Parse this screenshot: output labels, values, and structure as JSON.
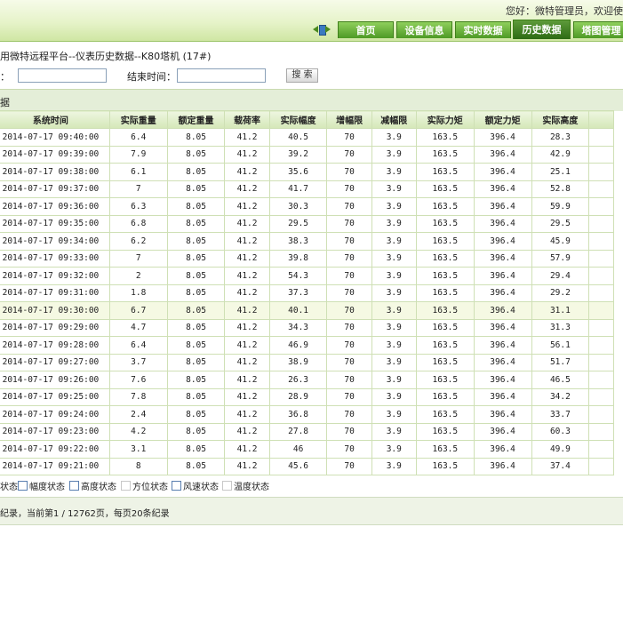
{
  "header": {
    "welcome": "您好：微特管理员，欢迎使",
    "nav": [
      "首页",
      "设备信息",
      "实时数据",
      "历史数据",
      "塔图管理"
    ],
    "active_tab": "历史数据"
  },
  "page_title": "用微特远程平台--仪表历史数据--K80塔机 (17#)",
  "search": {
    "start_label": "：",
    "end_label": "结束时间：",
    "start_value": "",
    "end_value": "",
    "button": "搜 索"
  },
  "panel_title": "据",
  "table": {
    "headers": [
      "系统时间",
      "实际重量",
      "额定重量",
      "载荷率",
      "实际幅度",
      "增幅限",
      "减幅限",
      "实际力矩",
      "额定力矩",
      "实际高度",
      ""
    ],
    "highlight_row": 10,
    "rows": [
      [
        "2014-07-17 09:40:00",
        "6.4",
        "8.05",
        "41.2",
        "40.5",
        "70",
        "3.9",
        "163.5",
        "396.4",
        "28.3",
        ""
      ],
      [
        "2014-07-17 09:39:00",
        "7.9",
        "8.05",
        "41.2",
        "39.2",
        "70",
        "3.9",
        "163.5",
        "396.4",
        "42.9",
        ""
      ],
      [
        "2014-07-17 09:38:00",
        "6.1",
        "8.05",
        "41.2",
        "35.6",
        "70",
        "3.9",
        "163.5",
        "396.4",
        "25.1",
        ""
      ],
      [
        "2014-07-17 09:37:00",
        "7",
        "8.05",
        "41.2",
        "41.7",
        "70",
        "3.9",
        "163.5",
        "396.4",
        "52.8",
        ""
      ],
      [
        "2014-07-17 09:36:00",
        "6.3",
        "8.05",
        "41.2",
        "30.3",
        "70",
        "3.9",
        "163.5",
        "396.4",
        "59.9",
        ""
      ],
      [
        "2014-07-17 09:35:00",
        "6.8",
        "8.05",
        "41.2",
        "29.5",
        "70",
        "3.9",
        "163.5",
        "396.4",
        "29.5",
        ""
      ],
      [
        "2014-07-17 09:34:00",
        "6.2",
        "8.05",
        "41.2",
        "38.3",
        "70",
        "3.9",
        "163.5",
        "396.4",
        "45.9",
        ""
      ],
      [
        "2014-07-17 09:33:00",
        "7",
        "8.05",
        "41.2",
        "39.8",
        "70",
        "3.9",
        "163.5",
        "396.4",
        "57.9",
        ""
      ],
      [
        "2014-07-17 09:32:00",
        "2",
        "8.05",
        "41.2",
        "54.3",
        "70",
        "3.9",
        "163.5",
        "396.4",
        "29.4",
        ""
      ],
      [
        "2014-07-17 09:31:00",
        "1.8",
        "8.05",
        "41.2",
        "37.3",
        "70",
        "3.9",
        "163.5",
        "396.4",
        "29.2",
        ""
      ],
      [
        "2014-07-17 09:30:00",
        "6.7",
        "8.05",
        "41.2",
        "40.1",
        "70",
        "3.9",
        "163.5",
        "396.4",
        "31.1",
        ""
      ],
      [
        "2014-07-17 09:29:00",
        "4.7",
        "8.05",
        "41.2",
        "34.3",
        "70",
        "3.9",
        "163.5",
        "396.4",
        "31.3",
        ""
      ],
      [
        "2014-07-17 09:28:00",
        "6.4",
        "8.05",
        "41.2",
        "46.9",
        "70",
        "3.9",
        "163.5",
        "396.4",
        "56.1",
        ""
      ],
      [
        "2014-07-17 09:27:00",
        "3.7",
        "8.05",
        "41.2",
        "38.9",
        "70",
        "3.9",
        "163.5",
        "396.4",
        "51.7",
        ""
      ],
      [
        "2014-07-17 09:26:00",
        "7.6",
        "8.05",
        "41.2",
        "26.3",
        "70",
        "3.9",
        "163.5",
        "396.4",
        "46.5",
        ""
      ],
      [
        "2014-07-17 09:25:00",
        "7.8",
        "8.05",
        "41.2",
        "28.9",
        "70",
        "3.9",
        "163.5",
        "396.4",
        "34.2",
        ""
      ],
      [
        "2014-07-17 09:24:00",
        "2.4",
        "8.05",
        "41.2",
        "36.8",
        "70",
        "3.9",
        "163.5",
        "396.4",
        "33.7",
        ""
      ],
      [
        "2014-07-17 09:23:00",
        "4.2",
        "8.05",
        "41.2",
        "27.8",
        "70",
        "3.9",
        "163.5",
        "396.4",
        "60.3",
        ""
      ],
      [
        "2014-07-17 09:22:00",
        "3.1",
        "8.05",
        "41.2",
        "46",
        "70",
        "3.9",
        "163.5",
        "396.4",
        "49.9",
        ""
      ],
      [
        "2014-07-17 09:21:00",
        "8",
        "8.05",
        "41.2",
        "45.6",
        "70",
        "3.9",
        "163.5",
        "396.4",
        "37.4",
        ""
      ]
    ]
  },
  "checks": [
    {
      "label": "状态",
      "box": false,
      "light": false
    },
    {
      "label": "幅度状态",
      "box": true,
      "light": false
    },
    {
      "label": "高度状态",
      "box": true,
      "light": false
    },
    {
      "label": "方位状态",
      "box": true,
      "light": true
    },
    {
      "label": "风速状态",
      "box": true,
      "light": false
    },
    {
      "label": "温度状态",
      "box": true,
      "light": true
    }
  ],
  "footer": {
    "text": "纪录，当前第1 / 12762页，每页20条纪录"
  },
  "colors": {
    "nav_green": "#4e9a25",
    "nav_active": "#2d6b14",
    "header_bg": "#e6f3c9",
    "highlight_row": "#f5f9e3"
  }
}
